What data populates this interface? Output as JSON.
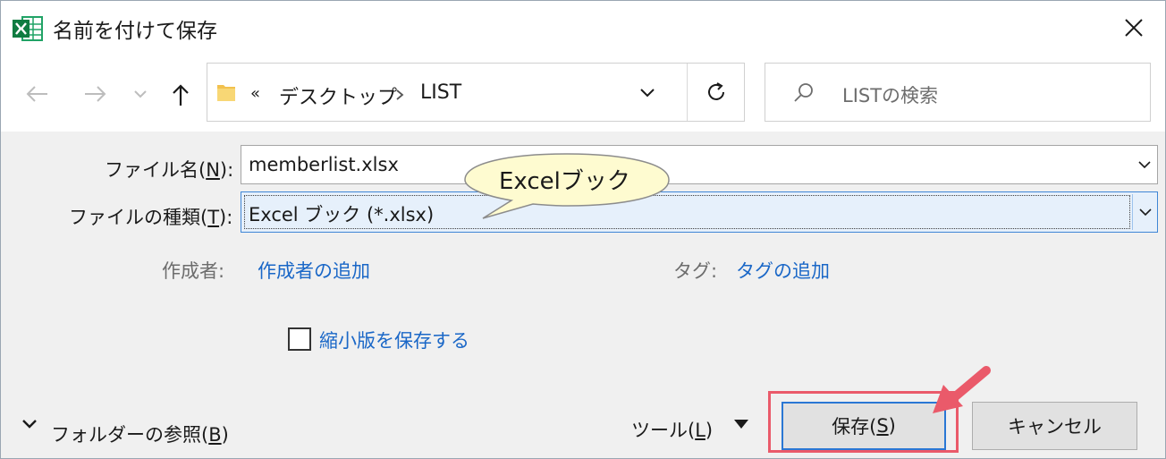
{
  "window": {
    "title": "名前を付けて保存",
    "app_icon": "excel-icon",
    "close_icon": "close-icon"
  },
  "nav": {
    "back_icon": "arrow-left-icon",
    "forward_icon": "arrow-right-icon",
    "recent_icon": "chevron-down-icon",
    "up_icon": "arrow-up-icon",
    "breadcrumb_overflow": "«",
    "breadcrumb": [
      "デスクトップ",
      "LIST"
    ],
    "refresh_icon": "refresh-icon",
    "search_placeholder": "LISTの検索"
  },
  "form": {
    "filename_label_prefix": "ファイル名(",
    "filename_label_key": "N",
    "filename_label_suffix": "):",
    "filename_value": "memberlist.xlsx",
    "filetype_label_prefix": "ファイルの種類(",
    "filetype_label_key": "T",
    "filetype_label_suffix": "):",
    "filetype_value": "Excel ブック (*.xlsx)",
    "author_label": "作成者:",
    "author_link": "作成者の追加",
    "tags_label": "タグ:",
    "tags_link": "タグの追加",
    "thumbnail_label": "縮小版を保存する",
    "thumbnail_checked": false
  },
  "footer": {
    "browse_prefix": "フォルダーの参照(",
    "browse_key": "B",
    "browse_suffix": ")",
    "tools_prefix": "ツール(",
    "tools_key": "L",
    "tools_suffix": ")",
    "save_prefix": "保存(",
    "save_key": "S",
    "save_suffix": ")",
    "cancel_label": "キャンセル"
  },
  "annotation": {
    "balloon_text": "Excelブック",
    "highlight_color": "#ea5a6a",
    "balloon_fill": "#fefbd0"
  },
  "colors": {
    "link": "#1a67c7",
    "panel": "#f0f0f0",
    "focus_border": "#2a77d4"
  }
}
